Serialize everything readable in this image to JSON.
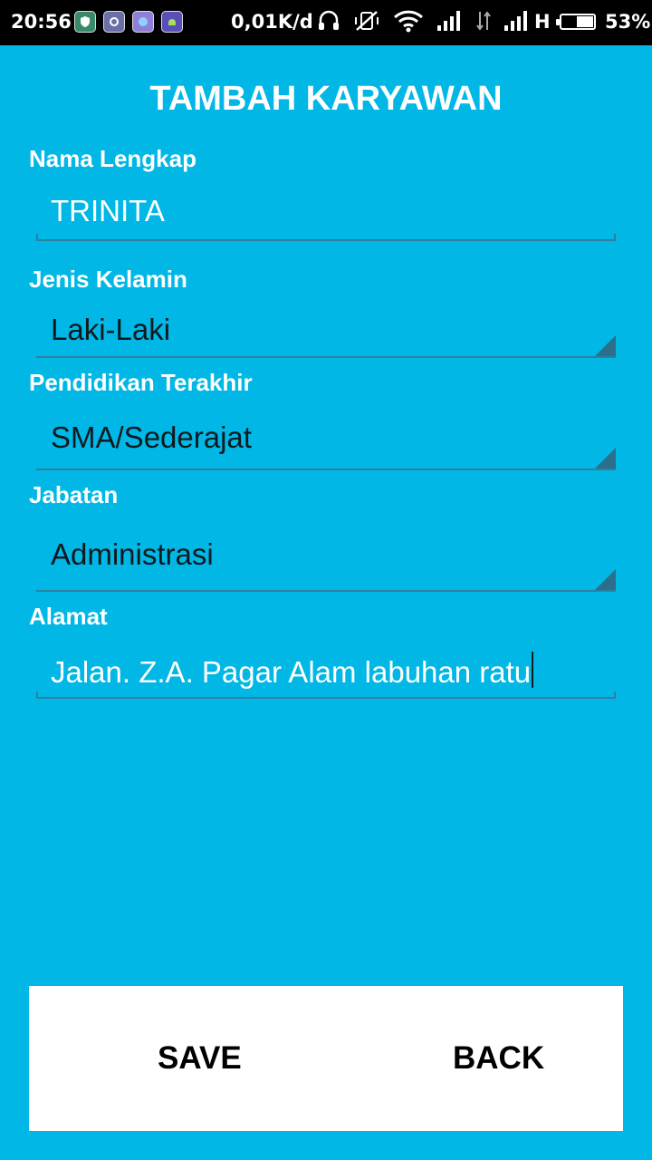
{
  "status_bar": {
    "time": "20:56",
    "speed": "0,01K/d",
    "network_type": "H",
    "battery_percent": "53%",
    "battery_level": 0.53,
    "icons": [
      "shield-app-icon",
      "app-icon",
      "app-icon",
      "android-app-icon",
      "headset-icon",
      "vibrate-off-icon",
      "wifi-icon",
      "signal-icon",
      "data-transfer-icon",
      "signal-icon",
      "battery-icon"
    ]
  },
  "title": "TAMBAH KARYAWAN",
  "form": {
    "nama": {
      "label": "Nama Lengkap",
      "value": "TRINITA"
    },
    "jenis_kelamin": {
      "label": "Jenis Kelamin",
      "value": "Laki-Laki"
    },
    "pendidikan": {
      "label": "Pendidikan Terakhir",
      "value": "SMA/Sederajat"
    },
    "jabatan": {
      "label": "Jabatan",
      "value": "Administrasi"
    },
    "alamat": {
      "label": "Alamat",
      "value": "Jalan. Z.A. Pagar Alam labuhan ratu"
    }
  },
  "buttons": {
    "save": "SAVE",
    "back": "BACK"
  },
  "colors": {
    "background": "#00b7e6",
    "panel": "#ffffff",
    "underline": "#2e7fa0"
  }
}
